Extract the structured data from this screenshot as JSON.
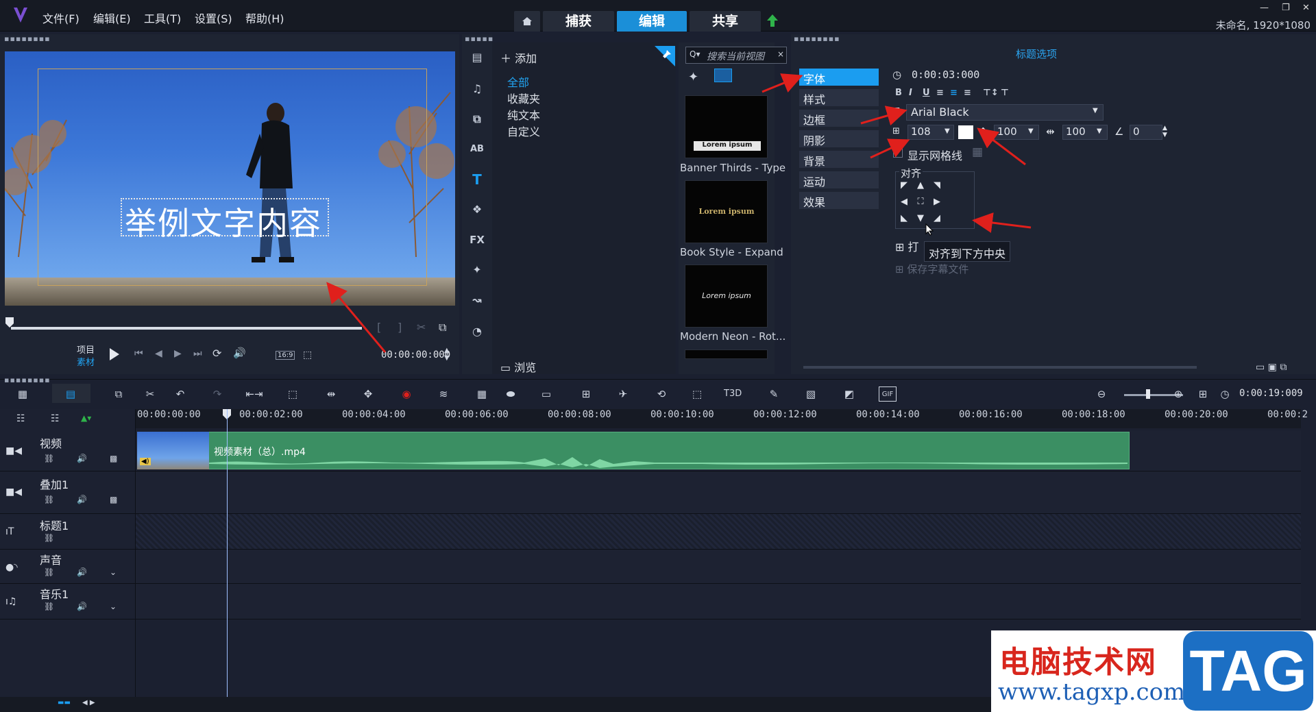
{
  "menu": {
    "items": [
      "文件(F)",
      "编辑(E)",
      "工具(T)",
      "设置(S)",
      "帮助(H)"
    ]
  },
  "modes": {
    "capture": "捕获",
    "edit": "编辑",
    "share": "共享"
  },
  "window": {
    "project": "未命名, 1920*1080"
  },
  "preview": {
    "caption": "举例文字内容",
    "project_label": "项目",
    "clip_label": "素材",
    "aspect": "16:9",
    "timecode": "00:00:00:000"
  },
  "library": {
    "add_label": "添加",
    "categories": [
      "全部",
      "收藏夹",
      "纯文本",
      "自定义"
    ],
    "browse_label": "浏览",
    "search_placeholder": "搜索当前视图",
    "thumbs": [
      {
        "label": "Banner Thirds - Type",
        "text": "Lorem ipsum"
      },
      {
        "label": "Book Style - Expand",
        "text": "Lorem ipsum"
      },
      {
        "label": "Modern Neon - Rot...",
        "text": "Lorem ipsum"
      }
    ]
  },
  "options": {
    "title": "标题选项",
    "tabs": [
      "字体",
      "样式",
      "边框",
      "阴影",
      "背景",
      "运动",
      "效果"
    ],
    "duration": "0:00:03:000",
    "font": "Arial Black",
    "size": "108",
    "line_spacing": "100",
    "char_spacing": "100",
    "angle": "0",
    "show_grid": "显示网格线",
    "align_label": "对齐",
    "tooltip": "对齐到下方中央",
    "open_label": "打",
    "save_label": "保存字幕文件",
    "text_color": "#ffffff"
  },
  "timeline": {
    "total_time": "0:00:19:009",
    "ticks": [
      "00:00:00:00",
      "00:00:02:00",
      "00:00:04:00",
      "00:00:06:00",
      "00:00:08:00",
      "00:00:10:00",
      "00:00:12:00",
      "00:00:14:00",
      "00:00:16:00",
      "00:00:18:00",
      "00:00:20:00",
      "00:00:2"
    ],
    "tracks": [
      "视频",
      "叠加1",
      "标题1",
      "声音",
      "音乐1"
    ],
    "clip_name": "视频素材（总）.mp4"
  },
  "watermark": {
    "cn": "电脑技术网",
    "url": "www.tagxp.com",
    "tag": "TAG"
  },
  "colors": {
    "accent": "#1b9df0",
    "clip": "#3b8f63",
    "arrow": "#e0201c"
  }
}
